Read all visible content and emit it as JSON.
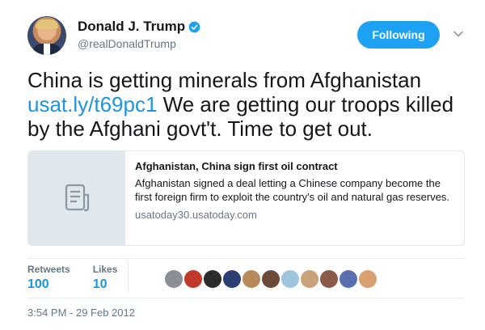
{
  "tweet": {
    "author": {
      "display_name": "Donald J. Trump",
      "handle": "@realDonaldTrump",
      "verified_icon": "verified-badge-icon"
    },
    "follow_button_label": "Following",
    "text_before": "China is getting minerals from Afghanistan ",
    "link_text": "usat.ly/t69pc1",
    "text_after": " We are getting our troops killed by the Afghani govt't.  Time to get out.",
    "card": {
      "thumbnail_icon": "document-icon",
      "title": "Afghanistan, China sign first oil contract",
      "description": "Afghanistan signed a deal letting a Chinese company become the first foreign firm to exploit the country's oil and natural gas reserves.",
      "domain": "usatoday30.usatoday.com"
    },
    "stats": {
      "retweets_label": "Retweets",
      "retweets_value": "100",
      "likes_label": "Likes",
      "likes_value": "10"
    },
    "liker_avatar_colors": [
      "#8a8f96",
      "#c0392b",
      "#2c2c2c",
      "#2d3e75",
      "#b88a5a",
      "#6b4a3a",
      "#9ec5e0",
      "#c9a27a",
      "#8a5a4a",
      "#5a6fb0",
      "#d9a070"
    ],
    "timestamp": "3:54 PM - 29 Feb 2012"
  },
  "colors": {
    "accent": "#1da1f2",
    "link": "#1b95e0",
    "secondary_text": "#657786"
  }
}
